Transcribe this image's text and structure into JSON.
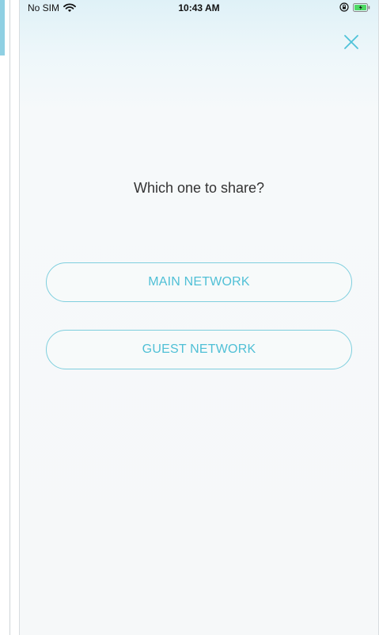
{
  "status_bar": {
    "carrier": "No SIM",
    "time": "10:43 AM",
    "icons": [
      "wifi-icon",
      "orientation-lock-icon",
      "battery-icon"
    ]
  },
  "dialog": {
    "question": "Which one to share?",
    "options": [
      {
        "label": "MAIN NETWORK"
      },
      {
        "label": "GUEST NETWORK"
      }
    ],
    "close_icon": "close-icon"
  },
  "colors": {
    "accent": "#50c0d6",
    "button_border": "#7fcfde",
    "text": "#333333",
    "battery": "#4cd964"
  }
}
